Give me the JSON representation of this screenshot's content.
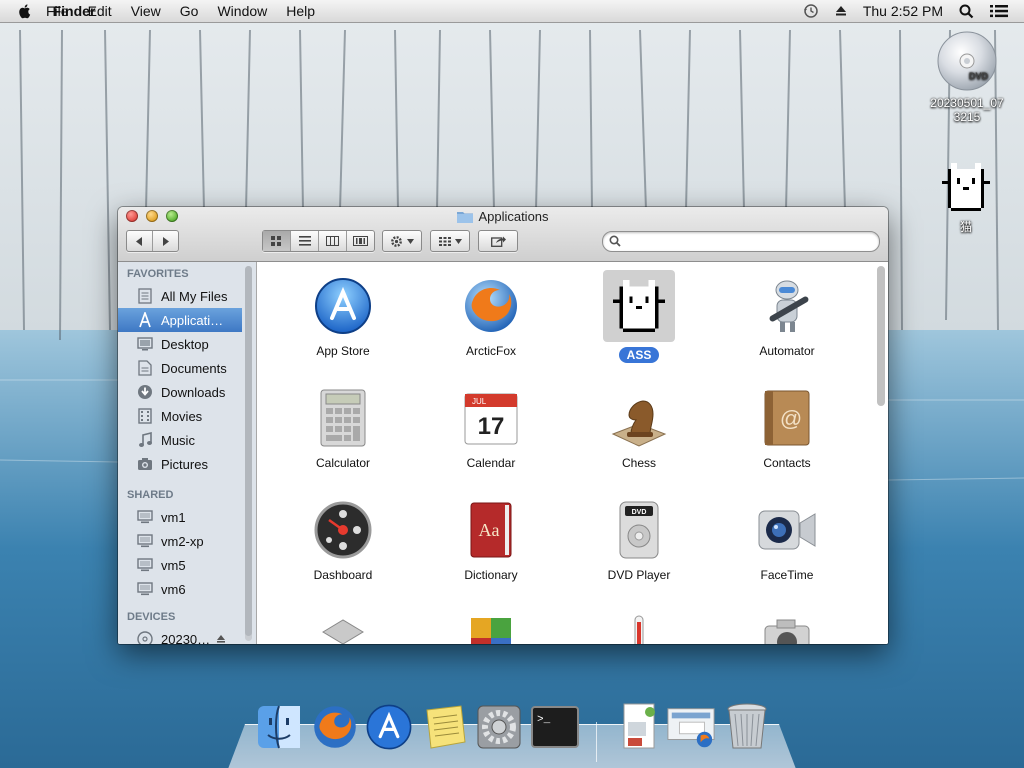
{
  "menubar": {
    "app_name": "Finder",
    "items": [
      "File",
      "Edit",
      "View",
      "Go",
      "Window",
      "Help"
    ],
    "clock": "Thu 2:52 PM"
  },
  "desktop": {
    "dvd_label": "20230501_07\n3215",
    "cat_label": "猫"
  },
  "window": {
    "title": "Applications",
    "search_placeholder": ""
  },
  "sidebar": {
    "favorites_header": "FAVORITES",
    "favorites": [
      {
        "label": "All My Files",
        "icon": "all-files-icon"
      },
      {
        "label": "Applicati…",
        "icon": "applications-icon",
        "selected": true
      },
      {
        "label": "Desktop",
        "icon": "desktop-icon"
      },
      {
        "label": "Documents",
        "icon": "documents-icon"
      },
      {
        "label": "Downloads",
        "icon": "downloads-icon"
      },
      {
        "label": "Movies",
        "icon": "movies-icon"
      },
      {
        "label": "Music",
        "icon": "music-icon"
      },
      {
        "label": "Pictures",
        "icon": "pictures-icon"
      }
    ],
    "shared_header": "SHARED",
    "shared": [
      {
        "label": "vm1"
      },
      {
        "label": "vm2-xp"
      },
      {
        "label": "vm5"
      },
      {
        "label": "vm6"
      }
    ],
    "devices_header": "DEVICES",
    "devices": [
      {
        "label": "20230…"
      }
    ]
  },
  "apps": [
    {
      "label": "App Store"
    },
    {
      "label": "ArcticFox"
    },
    {
      "label": "ASS",
      "selected": true
    },
    {
      "label": "Automator"
    },
    {
      "label": "Calculator"
    },
    {
      "label": "Calendar",
      "month": "JUL",
      "day": "17"
    },
    {
      "label": "Chess"
    },
    {
      "label": "Contacts"
    },
    {
      "label": "Dashboard"
    },
    {
      "label": "Dictionary"
    },
    {
      "label": "DVD Player"
    },
    {
      "label": "FaceTime"
    }
  ],
  "dock": [
    "Finder",
    "ArcticFox",
    "App Store",
    "Stickies",
    "System Preferences",
    "Terminal",
    "Documents",
    "Downloads",
    "Trash"
  ]
}
